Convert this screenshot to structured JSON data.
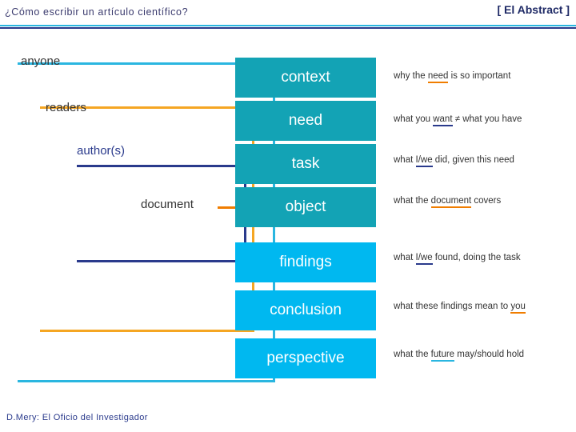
{
  "header": {
    "title": "¿Cómo escribir un artículo científico?",
    "right_label": "[ El Abstract ]",
    "rule_top_color": "#2ab6e0",
    "rule_bottom_color": "#2a3a8c"
  },
  "brackets": [
    {
      "name": "anyone",
      "label": "anyone",
      "color": "#2ab6e0"
    },
    {
      "name": "readers",
      "label": "readers",
      "color": "#f5a623"
    },
    {
      "name": "authors",
      "label": "author(s)",
      "color": "#2a3a8c"
    },
    {
      "name": "document",
      "label": "document",
      "color": "#f07d00"
    }
  ],
  "boxes": [
    {
      "label": "context",
      "color": "#13a3b5"
    },
    {
      "label": "need",
      "color": "#13a3b5"
    },
    {
      "label": "task",
      "color": "#13a3b5"
    },
    {
      "label": "object",
      "color": "#13a3b5"
    },
    {
      "label": "findings",
      "color": "#00b8f0"
    },
    {
      "label": "conclusion",
      "color": "#00b8f0"
    },
    {
      "label": "perspective",
      "color": "#00b8f0"
    }
  ],
  "annotations": [
    {
      "pre": "why the ",
      "mark": "need",
      "mark_style": "orange",
      "post": " is so important"
    },
    {
      "pre": "what you ",
      "mark": "want",
      "mark_style": "blue",
      "post": " ≠ what you have"
    },
    {
      "pre": "what ",
      "mark": "I/we",
      "mark_style": "blue",
      "post": " did, given this need"
    },
    {
      "pre": "what the ",
      "mark": "document",
      "mark_style": "orange",
      "post": " covers"
    },
    {
      "pre": "what ",
      "mark": "I/we",
      "mark_style": "blue",
      "post": " found, doing the task"
    },
    {
      "pre": "what these findings mean to ",
      "mark": "you",
      "mark_style": "orange",
      "post": ""
    },
    {
      "pre": "what the ",
      "mark": "future",
      "mark_style": "cyan",
      "post": " may/should hold"
    }
  ],
  "footer": {
    "text": "D.Mery: El Oficio del Investigador"
  }
}
